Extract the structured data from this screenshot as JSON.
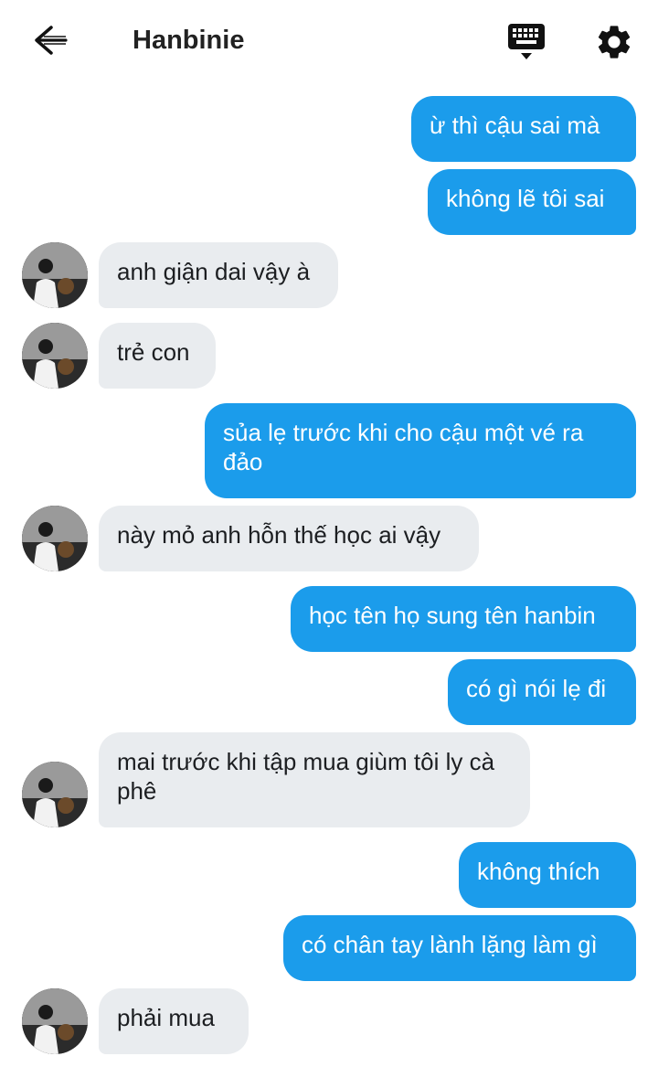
{
  "header": {
    "title": "Hanbinie",
    "back_icon": "arrow-left-icon",
    "keyboard_icon": "keyboard-icon",
    "settings_icon": "gear-icon"
  },
  "colors": {
    "outgoing": "#1b9ceb",
    "incoming": "#e9ecef"
  },
  "messages": [
    {
      "from": "me",
      "text": "ừ thì cậu sai mà"
    },
    {
      "from": "me",
      "text": "không lẽ tôi sai"
    },
    {
      "from": "them",
      "text": "anh giận dai vậy à"
    },
    {
      "from": "them",
      "text": "trẻ con"
    },
    {
      "from": "me",
      "text": "sủa lẹ trước khi cho cậu một vé ra đảo"
    },
    {
      "from": "them",
      "text": "này mỏ anh hỗn thế học ai vậy"
    },
    {
      "from": "me",
      "text": "học tên họ sung tên hanbin"
    },
    {
      "from": "me",
      "text": "có gì nói lẹ đi"
    },
    {
      "from": "them",
      "text": "mai trước khi tập mua giùm tôi ly cà phê"
    },
    {
      "from": "me",
      "text": "không thích"
    },
    {
      "from": "me",
      "text": "có chân tay lành lặng làm gì"
    },
    {
      "from": "them",
      "text": "phải mua"
    }
  ]
}
